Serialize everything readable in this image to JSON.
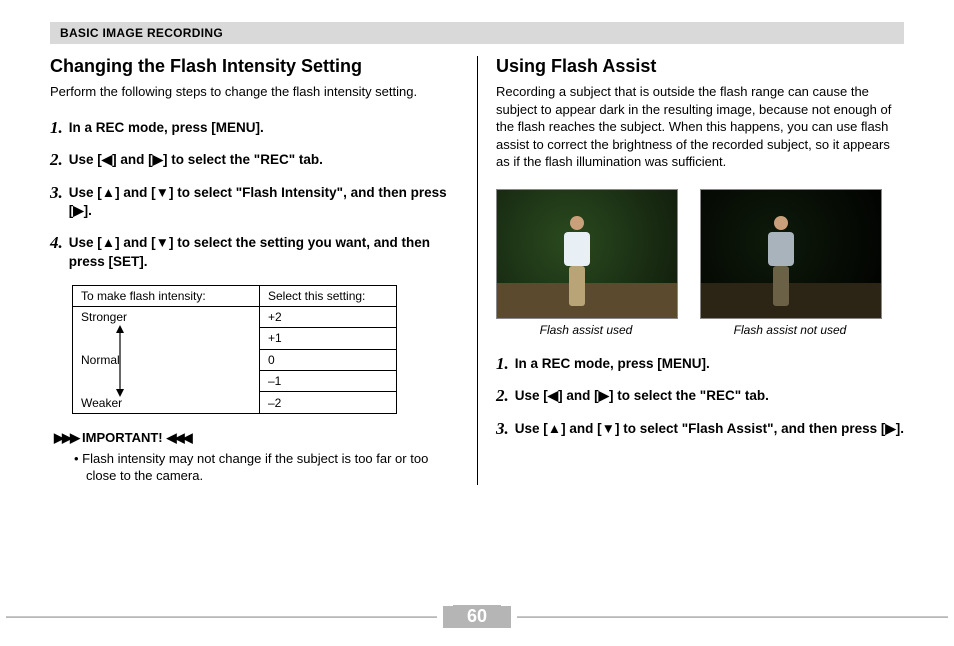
{
  "section_bar": "BASIC IMAGE RECORDING",
  "left": {
    "heading": "Changing the Flash Intensity Setting",
    "intro": "Perform the following steps to change the flash intensity setting.",
    "steps": [
      "In a REC mode, press [MENU].",
      "Use [◀] and [▶] to select the \"REC\" tab.",
      "Use [▲] and [▼] to select \"Flash Intensity\", and then press [▶].",
      "Use [▲] and [▼] to select the setting you want, and then press [SET]."
    ],
    "table": {
      "header_a": "To make flash intensity:",
      "header_b": "Select this setting:",
      "rows": [
        {
          "a": "Stronger",
          "b": "+2"
        },
        {
          "a": "",
          "b": "+1"
        },
        {
          "a": "Normal",
          "b": " 0"
        },
        {
          "a": "",
          "b": "–1"
        },
        {
          "a": "Weaker",
          "b": "–2"
        }
      ]
    },
    "important_label": "IMPORTANT!",
    "important_bullet": "Flash intensity may not change if the subject is too far or too close to the camera."
  },
  "right": {
    "heading": "Using Flash Assist",
    "intro": "Recording a subject that is outside the flash range can cause the subject to appear dark in the resulting image, because not enough of the flash reaches the subject. When this happens, you can use flash assist to correct the brightness of the recorded subject, so it appears as if the flash illumination was sufficient.",
    "caption_used": "Flash assist used",
    "caption_notused": "Flash assist not used",
    "steps": [
      "In a REC mode, press [MENU].",
      "Use [◀] and [▶] to select the \"REC\" tab.",
      "Use [▲] and [▼] to select \"Flash Assist\", and then press [▶]."
    ]
  },
  "page_number": "60"
}
